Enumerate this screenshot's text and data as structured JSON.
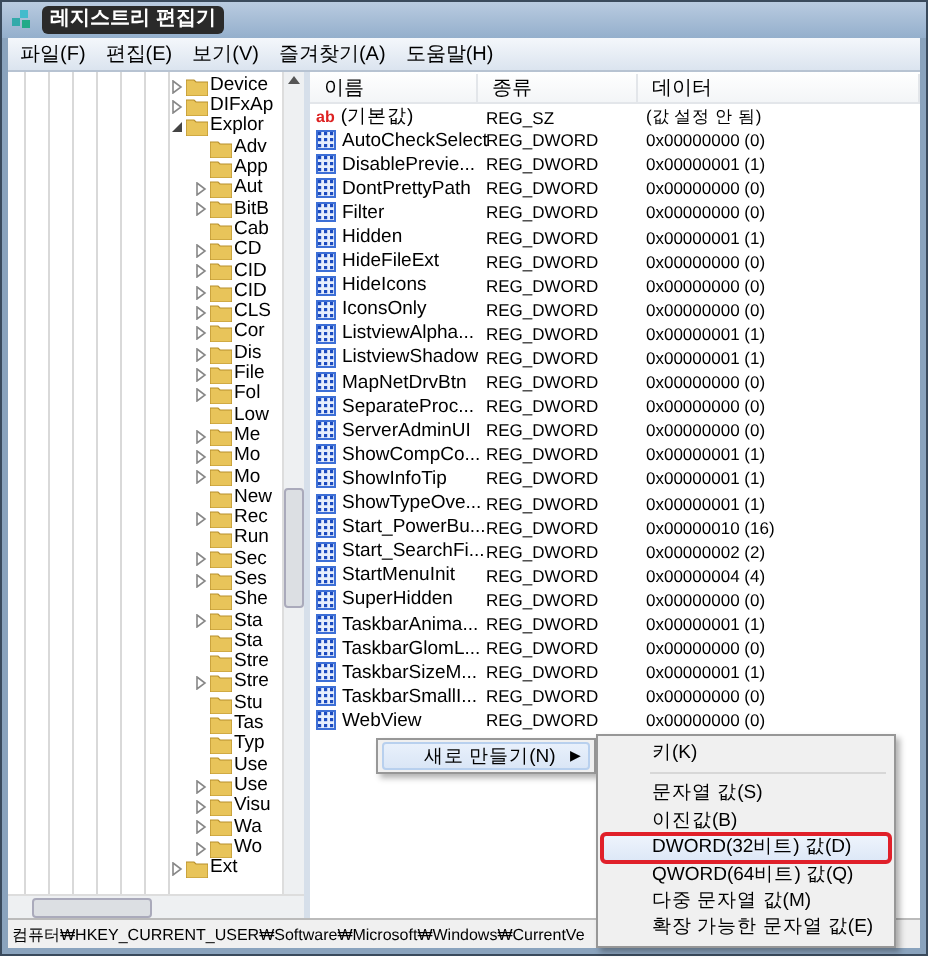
{
  "window": {
    "title": "레지스트리 편집기"
  },
  "menu": [
    "파일(F)",
    "편집(E)",
    "보기(V)",
    "즐겨찾기(A)",
    "도움말(H)"
  ],
  "tree": [
    {
      "label": "Device",
      "kind": "collapsed"
    },
    {
      "label": "DIFxAp",
      "kind": "collapsed"
    },
    {
      "label": "Explor",
      "kind": "expanded",
      "children": [
        {
          "label": "Adv",
          "kind": "leaf"
        },
        {
          "label": "App",
          "kind": "leaf"
        },
        {
          "label": "Aut",
          "kind": "collapsed"
        },
        {
          "label": "BitB",
          "kind": "collapsed"
        },
        {
          "label": "Cab",
          "kind": "leaf"
        },
        {
          "label": "CD",
          "kind": "collapsed"
        },
        {
          "label": "CID",
          "kind": "collapsed"
        },
        {
          "label": "CID",
          "kind": "collapsed"
        },
        {
          "label": "CLS",
          "kind": "collapsed"
        },
        {
          "label": "Cor",
          "kind": "collapsed"
        },
        {
          "label": "Dis",
          "kind": "collapsed"
        },
        {
          "label": "File",
          "kind": "collapsed"
        },
        {
          "label": "Fol",
          "kind": "collapsed"
        },
        {
          "label": "Low",
          "kind": "leaf"
        },
        {
          "label": "Me",
          "kind": "collapsed"
        },
        {
          "label": "Mo",
          "kind": "collapsed"
        },
        {
          "label": "Mo",
          "kind": "collapsed"
        },
        {
          "label": "New",
          "kind": "leaf"
        },
        {
          "label": "Rec",
          "kind": "collapsed"
        },
        {
          "label": "Run",
          "kind": "leaf"
        },
        {
          "label": "Sec",
          "kind": "collapsed"
        },
        {
          "label": "Ses",
          "kind": "collapsed"
        },
        {
          "label": "She",
          "kind": "leaf"
        },
        {
          "label": "Sta",
          "kind": "collapsed"
        },
        {
          "label": "Sta",
          "kind": "leaf"
        },
        {
          "label": "Stre",
          "kind": "leaf"
        },
        {
          "label": "Stre",
          "kind": "collapsed"
        },
        {
          "label": "Stu",
          "kind": "leaf"
        },
        {
          "label": "Tas",
          "kind": "leaf"
        },
        {
          "label": "Typ",
          "kind": "leaf"
        },
        {
          "label": "Use",
          "kind": "leaf"
        },
        {
          "label": "Use",
          "kind": "collapsed"
        },
        {
          "label": "Visu",
          "kind": "collapsed"
        },
        {
          "label": "Wa",
          "kind": "collapsed"
        },
        {
          "label": "Wo",
          "kind": "collapsed"
        }
      ]
    },
    {
      "label": "Ext",
      "kind": "collapsed"
    }
  ],
  "table": {
    "columns": [
      "이름",
      "종류",
      "데이터"
    ],
    "rows": [
      {
        "kind": "string",
        "icon": "ab",
        "name": "(기본값)",
        "type": "REG_SZ",
        "data": "(값 설정 안 됨)"
      },
      {
        "kind": "dword",
        "name": "AutoCheckSelect",
        "type": "REG_DWORD",
        "data": "0x00000000 (0)"
      },
      {
        "kind": "dword",
        "name": "DisablePrevie...",
        "type": "REG_DWORD",
        "data": "0x00000001 (1)"
      },
      {
        "kind": "dword",
        "name": "DontPrettyPath",
        "type": "REG_DWORD",
        "data": "0x00000000 (0)"
      },
      {
        "kind": "dword",
        "name": "Filter",
        "type": "REG_DWORD",
        "data": "0x00000000 (0)"
      },
      {
        "kind": "dword",
        "name": "Hidden",
        "type": "REG_DWORD",
        "data": "0x00000001 (1)"
      },
      {
        "kind": "dword",
        "name": "HideFileExt",
        "type": "REG_DWORD",
        "data": "0x00000000 (0)"
      },
      {
        "kind": "dword",
        "name": "HideIcons",
        "type": "REG_DWORD",
        "data": "0x00000000 (0)"
      },
      {
        "kind": "dword",
        "name": "IconsOnly",
        "type": "REG_DWORD",
        "data": "0x00000000 (0)"
      },
      {
        "kind": "dword",
        "name": "ListviewAlpha...",
        "type": "REG_DWORD",
        "data": "0x00000001 (1)"
      },
      {
        "kind": "dword",
        "name": "ListviewShadow",
        "type": "REG_DWORD",
        "data": "0x00000001 (1)"
      },
      {
        "kind": "dword",
        "name": "MapNetDrvBtn",
        "type": "REG_DWORD",
        "data": "0x00000000 (0)"
      },
      {
        "kind": "dword",
        "name": "SeparateProc...",
        "type": "REG_DWORD",
        "data": "0x00000000 (0)"
      },
      {
        "kind": "dword",
        "name": "ServerAdminUI",
        "type": "REG_DWORD",
        "data": "0x00000000 (0)"
      },
      {
        "kind": "dword",
        "name": "ShowCompCo...",
        "type": "REG_DWORD",
        "data": "0x00000001 (1)"
      },
      {
        "kind": "dword",
        "name": "ShowInfoTip",
        "type": "REG_DWORD",
        "data": "0x00000001 (1)"
      },
      {
        "kind": "dword",
        "name": "ShowTypeOve...",
        "type": "REG_DWORD",
        "data": "0x00000001 (1)"
      },
      {
        "kind": "dword",
        "name": "Start_PowerBu...",
        "type": "REG_DWORD",
        "data": "0x00000010 (16)"
      },
      {
        "kind": "dword",
        "name": "Start_SearchFi...",
        "type": "REG_DWORD",
        "data": "0x00000002 (2)"
      },
      {
        "kind": "dword",
        "name": "StartMenuInit",
        "type": "REG_DWORD",
        "data": "0x00000004 (4)"
      },
      {
        "kind": "dword",
        "name": "SuperHidden",
        "type": "REG_DWORD",
        "data": "0x00000000 (0)"
      },
      {
        "kind": "dword",
        "name": "TaskbarAnima...",
        "type": "REG_DWORD",
        "data": "0x00000001 (1)"
      },
      {
        "kind": "dword",
        "name": "TaskbarGlomL...",
        "type": "REG_DWORD",
        "data": "0x00000000 (0)"
      },
      {
        "kind": "dword",
        "name": "TaskbarSizeM...",
        "type": "REG_DWORD",
        "data": "0x00000001 (1)"
      },
      {
        "kind": "dword",
        "name": "TaskbarSmallI...",
        "type": "REG_DWORD",
        "data": "0x00000000 (0)"
      },
      {
        "kind": "dword",
        "name": "WebView",
        "type": "REG_DWORD",
        "data": "0x00000000 (0)"
      }
    ]
  },
  "context_menu": {
    "label": "새로 만들기(N)",
    "arrow": "▶"
  },
  "submenu": [
    {
      "kind": "item",
      "label": "키(K)",
      "selected": false,
      "annotated": false
    },
    {
      "kind": "separator"
    },
    {
      "kind": "item",
      "label": "문자열 값(S)",
      "selected": false,
      "annotated": false
    },
    {
      "kind": "item",
      "label": "이진값(B)",
      "selected": false,
      "annotated": false
    },
    {
      "kind": "item",
      "label": "DWORD(32비트) 값(D)",
      "selected": true,
      "annotated": true
    },
    {
      "kind": "item",
      "label": "QWORD(64비트) 값(Q)",
      "selected": false,
      "annotated": false
    },
    {
      "kind": "item",
      "label": "다중 문자열 값(M)",
      "selected": false,
      "annotated": false
    },
    {
      "kind": "item",
      "label": "확장 가능한 문자열 값(E)",
      "selected": false,
      "annotated": false
    }
  ],
  "status_bar": "컴퓨터₩HKEY_CURRENT_USER₩Software₩Microsoft₩Windows₩CurrentVe"
}
